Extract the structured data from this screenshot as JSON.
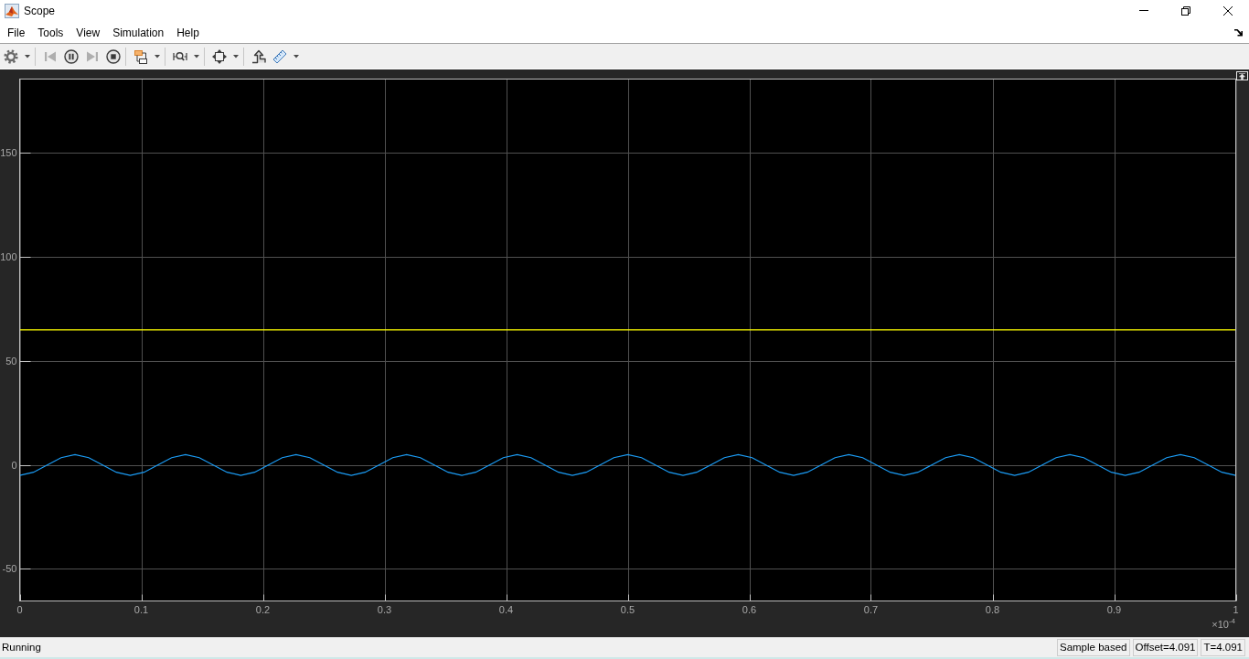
{
  "window": {
    "title": "Scope"
  },
  "menu": [
    "File",
    "Tools",
    "View",
    "Simulation",
    "Help"
  ],
  "toolbar": [
    [
      {
        "kind": "gear",
        "disabled": false,
        "dropdown": true
      }
    ],
    [
      {
        "kind": "step-back",
        "disabled": true,
        "dropdown": false
      },
      {
        "kind": "pause",
        "disabled": false,
        "dropdown": false
      },
      {
        "kind": "step-forward",
        "disabled": true,
        "dropdown": false
      },
      {
        "kind": "stop",
        "disabled": false,
        "dropdown": false
      }
    ],
    [
      {
        "kind": "highlight",
        "disabled": false,
        "dropdown": true
      }
    ],
    [
      {
        "kind": "zoom",
        "disabled": false,
        "dropdown": true
      }
    ],
    [
      {
        "kind": "fit",
        "disabled": false,
        "dropdown": true
      }
    ],
    [
      {
        "kind": "trigger",
        "disabled": false,
        "dropdown": false
      },
      {
        "kind": "measure",
        "disabled": false,
        "dropdown": true
      }
    ]
  ],
  "plot": {
    "chart_data": {
      "type": "line",
      "grid": true,
      "x": [
        0,
        0.0114,
        0.0227,
        0.0341,
        0.0455,
        0.0568,
        0.0682,
        0.0795,
        0.0909,
        0.1023,
        0.1136,
        0.125,
        0.1364,
        0.1477,
        0.1591,
        0.1705,
        0.1818,
        0.1932,
        0.2045,
        0.2159,
        0.2273,
        0.2386,
        0.25,
        0.2614,
        0.2727,
        0.2841,
        0.2955,
        0.3068,
        0.3182,
        0.3295,
        0.3409,
        0.3523,
        0.3636,
        0.375,
        0.3864,
        0.3977,
        0.4091,
        0.4205,
        0.4318,
        0.4432,
        0.4545,
        0.4659,
        0.4773,
        0.4886,
        0.5,
        0.5114,
        0.5227,
        0.5341,
        0.5455,
        0.5568,
        0.5682,
        0.5795,
        0.5909,
        0.6023,
        0.6136,
        0.625,
        0.6364,
        0.6477,
        0.6591,
        0.6705,
        0.6818,
        0.6932,
        0.7045,
        0.7159,
        0.7273,
        0.7386,
        0.75,
        0.7614,
        0.7727,
        0.7841,
        0.7955,
        0.8068,
        0.8182,
        0.8295,
        0.8409,
        0.8523,
        0.8636,
        0.875,
        0.8864,
        0.8977,
        0.9091,
        0.9205,
        0.9318,
        0.9432,
        0.9545,
        0.9659,
        0.9773,
        0.9886,
        1
      ],
      "series": [
        {
          "color": "#ffff00",
          "values": [
            65,
            65,
            65,
            65,
            65,
            65,
            65,
            65,
            65,
            65,
            65,
            65,
            65,
            65,
            65,
            65,
            65,
            65,
            65,
            65,
            65,
            65,
            65,
            65,
            65,
            65,
            65,
            65,
            65,
            65,
            65,
            65,
            65,
            65,
            65,
            65,
            65,
            65,
            65,
            65,
            65,
            65,
            65,
            65,
            65,
            65,
            65,
            65,
            65,
            65,
            65,
            65,
            65,
            65,
            65,
            65,
            65,
            65,
            65,
            65,
            65,
            65,
            65,
            65,
            65,
            65,
            65,
            65,
            65,
            65,
            65,
            65,
            65,
            65,
            65,
            65,
            65,
            65,
            65,
            65,
            65,
            65,
            65,
            65,
            65,
            65,
            65,
            65,
            65
          ]
        },
        {
          "color": "#1b9cf5",
          "values": [
            -5,
            -3.5,
            0,
            3.5,
            5,
            3.5,
            0,
            -3.5,
            -5,
            -3.5,
            0,
            3.5,
            5,
            3.5,
            0,
            -3.5,
            -5,
            -3.5,
            0,
            3.5,
            5,
            3.5,
            0,
            -3.5,
            -5,
            -3.5,
            0,
            3.5,
            5,
            3.5,
            0,
            -3.5,
            -5,
            -3.5,
            0,
            3.5,
            5,
            3.5,
            0,
            -3.5,
            -5,
            -3.5,
            0,
            3.5,
            5,
            3.5,
            0,
            -3.5,
            -5,
            -3.5,
            0,
            3.5,
            5,
            3.5,
            0,
            -3.5,
            -5,
            -3.5,
            0,
            3.5,
            5,
            3.5,
            0,
            -3.5,
            -5,
            -3.5,
            0,
            3.5,
            5,
            3.5,
            0,
            -3.5,
            -5,
            -3.5,
            0,
            3.5,
            5,
            3.5,
            0,
            -3.5,
            -5,
            -3.5,
            0,
            3.5,
            5,
            3.5,
            0,
            -3.5,
            -5
          ]
        }
      ],
      "xlim": [
        0,
        1
      ],
      "ylim": [
        -65.4,
        185.6
      ],
      "xticks": [
        0,
        0.1,
        0.2,
        0.3,
        0.4,
        0.5,
        0.6,
        0.7,
        0.8,
        0.9,
        1
      ],
      "yticks": [
        -50,
        0,
        50,
        100,
        150
      ]
    },
    "x_multiplier": "×10$^{-4}$"
  },
  "status_bar": {
    "text": "Running",
    "fields": [
      "Sample based",
      "Offset=4.091",
      "T=4.091"
    ]
  }
}
